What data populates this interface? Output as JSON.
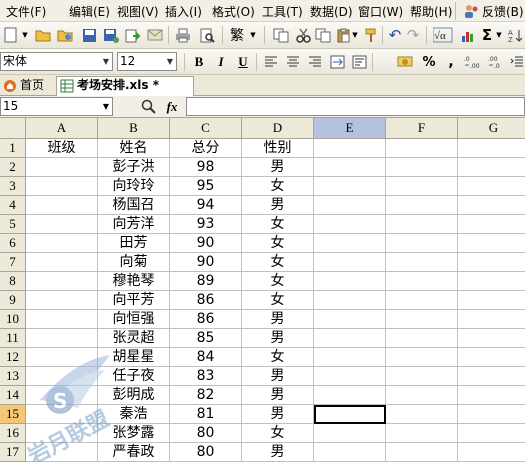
{
  "menubar": {
    "items": [
      "文件(F)",
      "编辑(E)",
      "视图(V)",
      "插入(I)",
      "格式(O)",
      "工具(T)",
      "数据(D)",
      "窗口(W)",
      "帮助(H)",
      "反馈(B)"
    ]
  },
  "toolbar": {
    "font_name": "宋体",
    "font_size": "12",
    "traditional": "繁",
    "bold": "B",
    "italic": "I",
    "underline": "U",
    "percent": "%",
    "comma": ",",
    "sum": "Σ"
  },
  "tabs": {
    "home": "首页",
    "file": "考场安排.xls *"
  },
  "formula": {
    "namebox": "15",
    "fx": "fx"
  },
  "sheet": {
    "columns": [
      "A",
      "B",
      "C",
      "D",
      "E",
      "F",
      "G"
    ],
    "selected_column": "E",
    "selected_row": "15",
    "rows": [
      {
        "num": "1",
        "a": "班级",
        "b": "姓名",
        "c": "总分",
        "d": "性别"
      },
      {
        "num": "2",
        "a": "",
        "b": "彭子洪",
        "c": "98",
        "d": "男"
      },
      {
        "num": "3",
        "a": "",
        "b": "向玲玲",
        "c": "95",
        "d": "女"
      },
      {
        "num": "4",
        "a": "",
        "b": "杨国召",
        "c": "94",
        "d": "男"
      },
      {
        "num": "5",
        "a": "",
        "b": "向芳洋",
        "c": "93",
        "d": "女"
      },
      {
        "num": "6",
        "a": "",
        "b": "田芳",
        "c": "90",
        "d": "女"
      },
      {
        "num": "7",
        "a": "",
        "b": "向菊",
        "c": "90",
        "d": "女"
      },
      {
        "num": "8",
        "a": "",
        "b": "穆艳琴",
        "c": "89",
        "d": "女"
      },
      {
        "num": "9",
        "a": "",
        "b": "向平芳",
        "c": "86",
        "d": "女"
      },
      {
        "num": "10",
        "a": "",
        "b": "向恒强",
        "c": "86",
        "d": "男"
      },
      {
        "num": "11",
        "a": "",
        "b": "张灵超",
        "c": "85",
        "d": "男"
      },
      {
        "num": "12",
        "a": "",
        "b": "胡星星",
        "c": "84",
        "d": "女"
      },
      {
        "num": "13",
        "a": "",
        "b": "任子夜",
        "c": "83",
        "d": "男"
      },
      {
        "num": "14",
        "a": "",
        "b": "彭明成",
        "c": "82",
        "d": "男"
      },
      {
        "num": "15",
        "a": "",
        "b": "秦浩",
        "c": "81",
        "d": "男"
      },
      {
        "num": "16",
        "a": "",
        "b": "张梦露",
        "c": "80",
        "d": "女"
      },
      {
        "num": "17",
        "a": "",
        "b": "严春政",
        "c": "80",
        "d": "男"
      }
    ]
  },
  "watermark": {
    "text": "岩月联盟",
    "colors": {
      "mark": "#7b9fc8"
    }
  },
  "colors": {
    "header_bg": "#ece9d8",
    "selected_col_header": "#b4c2e0",
    "selected_row_header": "#f4c675",
    "gridline": "#c0c0c0"
  }
}
